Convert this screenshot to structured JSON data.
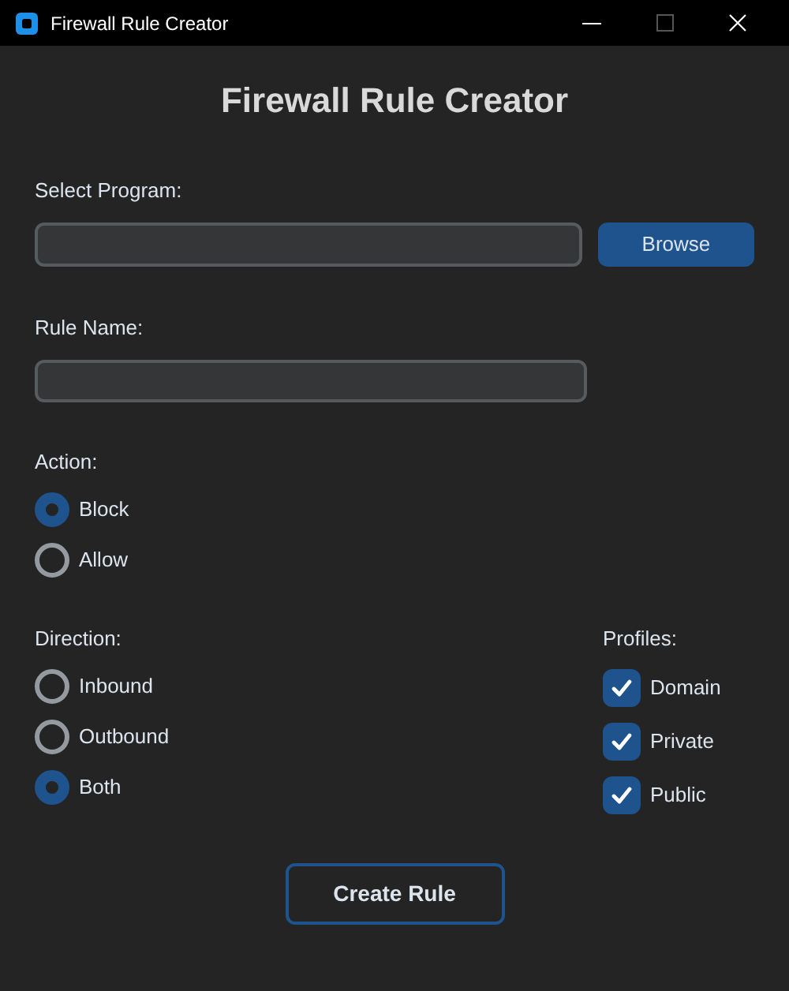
{
  "window": {
    "title": "Firewall Rule Creator"
  },
  "heading": "Firewall Rule Creator",
  "program": {
    "label": "Select Program:",
    "button": "Browse"
  },
  "rule_name": {
    "label": "Rule Name:"
  },
  "action": {
    "label": "Action:",
    "options": [
      {
        "label": "Block",
        "selected": true
      },
      {
        "label": "Allow",
        "selected": false
      }
    ]
  },
  "direction": {
    "label": "Direction:",
    "options": [
      {
        "label": "Inbound",
        "selected": false
      },
      {
        "label": "Outbound",
        "selected": false
      },
      {
        "label": "Both",
        "selected": true
      }
    ]
  },
  "profiles": {
    "label": "Profiles:",
    "options": [
      {
        "label": "Domain",
        "checked": true
      },
      {
        "label": "Private",
        "checked": true
      },
      {
        "label": "Public",
        "checked": true
      }
    ]
  },
  "submit_button": "Create Rule"
}
